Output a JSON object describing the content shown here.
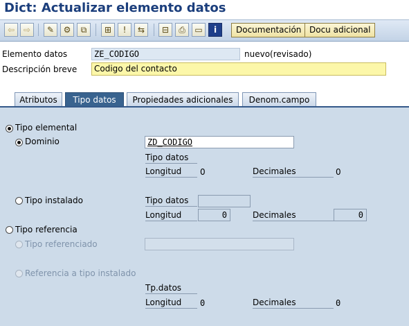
{
  "window": {
    "title": "Dict: Actualizar elemento datos"
  },
  "toolbar": {
    "doc_button": "Documentación",
    "doc_extra_button": "Docu adicional"
  },
  "header": {
    "data_element_label": "Elemento datos",
    "data_element_value": "ZE_CODIGO",
    "status": "nuevo(revisado)",
    "short_desc_label": "Descripción breve",
    "short_desc_value": "Codigo del contacto"
  },
  "tabs": [
    {
      "label": "Atributos",
      "active": false
    },
    {
      "label": "Tipo datos",
      "active": true
    },
    {
      "label": "Propiedades adicionales",
      "active": false
    },
    {
      "label": "Denom.campo",
      "active": false
    }
  ],
  "panel": {
    "elementary_type": {
      "label": "Tipo elemental",
      "selected": true
    },
    "domain": {
      "label": "Dominio",
      "selected": true,
      "value": "ZD_CODIGO",
      "data_type_label": "Tipo datos",
      "length_label": "Longitud",
      "length_value": "0",
      "decimals_label": "Decimales",
      "decimals_value": "0"
    },
    "builtin_type": {
      "label": "Tipo instalado",
      "selected": false,
      "data_type_label": "Tipo datos",
      "length_label": "Longitud",
      "length_value": "0",
      "decimals_label": "Decimales",
      "decimals_value": "0"
    },
    "reference_type": {
      "label": "Tipo referencia",
      "selected": false
    },
    "referenced_type": {
      "label": "Tipo referenciado",
      "enabled": false
    },
    "ref_builtin": {
      "label": "Referencia a tipo instalado",
      "enabled": false,
      "data_type_label": "Tp.datos",
      "length_label": "Longitud",
      "length_value": "0",
      "decimals_label": "Decimales",
      "decimals_value": "0"
    }
  },
  "colors": {
    "title": "#1b3e7c",
    "panel_bg": "#cddbe9",
    "active_tab": "#39638f",
    "input_highlight": "#fcf7a9"
  }
}
